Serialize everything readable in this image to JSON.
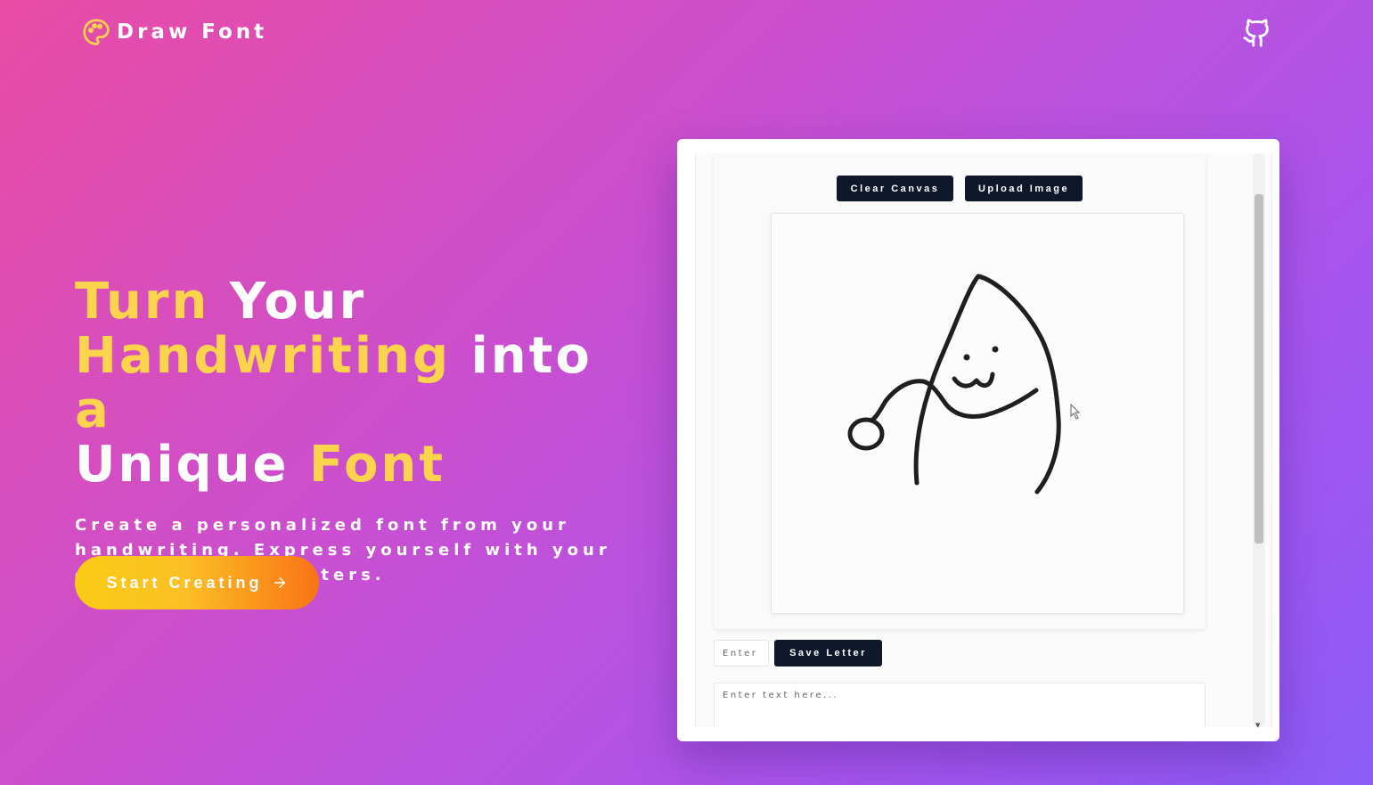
{
  "header": {
    "brand": "Draw Font",
    "logo_icon": "palette-icon",
    "github_icon": "github-icon"
  },
  "hero": {
    "headline": {
      "w1": "Turn",
      "w2": "Your",
      "w3": "Handwriting",
      "w4": "into",
      "w5": "a",
      "w6": "Unique",
      "w7": "Font"
    },
    "subtitle": "Create a personalized font from your handwriting. Express yourself with your own unique characters.",
    "cta_label": "Start Creating",
    "cta_icon": "arrow-right-icon"
  },
  "editor": {
    "clear_label": "Clear Canvas",
    "upload_label": "Upload Image",
    "letter_placeholder": "Enter",
    "save_label": "Save Letter",
    "text_placeholder": "Enter text here..."
  },
  "colors": {
    "accent_yellow": "#fcd34d",
    "button_dark": "#0f172a",
    "bg_gradient_start": "#e94ca3",
    "bg_gradient_end": "#8b5cf6"
  }
}
